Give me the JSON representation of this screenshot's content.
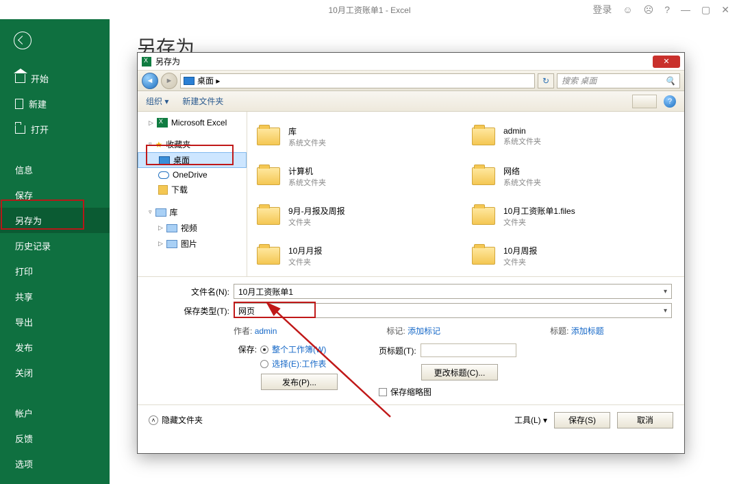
{
  "titlebar": {
    "title": "10月工资账单1  -  Excel",
    "login": "登录"
  },
  "sidebar": {
    "back": "返回",
    "items": [
      {
        "label": "开始",
        "icon": "home"
      },
      {
        "label": "新建",
        "icon": "doc"
      },
      {
        "label": "打开",
        "icon": "open"
      }
    ],
    "items2": [
      {
        "label": "信息"
      },
      {
        "label": "保存"
      },
      {
        "label": "另存为",
        "active": true
      },
      {
        "label": "历史记录"
      },
      {
        "label": "打印"
      },
      {
        "label": "共享"
      },
      {
        "label": "导出"
      },
      {
        "label": "发布"
      },
      {
        "label": "关闭"
      }
    ],
    "items3": [
      {
        "label": "帐户"
      },
      {
        "label": "反馈"
      },
      {
        "label": "选项"
      }
    ]
  },
  "main": {
    "heading": "另存为"
  },
  "dialog": {
    "title": "另存为",
    "breadcrumb": "桌面  ▸",
    "search_placeholder": "搜索 桌面",
    "toolbar": {
      "organize": "组织 ▾",
      "newfolder": "新建文件夹"
    },
    "tree": {
      "excel": "Microsoft Excel",
      "favorites": "收藏夹",
      "desktop": "桌面",
      "onedrive": "OneDrive",
      "downloads": "下载",
      "libraries": "库",
      "videos": "视频",
      "pictures": "图片"
    },
    "files": [
      {
        "name": "库",
        "sub": "系统文件夹"
      },
      {
        "name": "admin",
        "sub": "系统文件夹"
      },
      {
        "name": "计算机",
        "sub": "系统文件夹"
      },
      {
        "name": "网络",
        "sub": "系统文件夹"
      },
      {
        "name": "9月-月报及周报",
        "sub": "文件夹"
      },
      {
        "name": "10月工资账单1.files",
        "sub": "文件夹"
      },
      {
        "name": "10月月报",
        "sub": "文件夹"
      },
      {
        "name": "10月周报",
        "sub": "文件夹"
      }
    ],
    "filename_label": "文件名(N):",
    "filename_value": "10月工资账单1",
    "type_label": "保存类型(T):",
    "type_value": "网页",
    "meta": {
      "author_label": "作者:",
      "author_value": "admin",
      "tag_label": "标记:",
      "tag_value": "添加标记",
      "title_label": "标题:",
      "title_value": "添加标题"
    },
    "opts": {
      "save_label": "保存:",
      "whole": "整个工作簿(W)",
      "select": "选择(E):工作表",
      "publish": "发布(P)...",
      "pagetitle_label": "页标题(T):",
      "change_title": "更改标题(C)...",
      "thumbnail": "保存缩略图"
    },
    "footer": {
      "hidefolders": "隐藏文件夹",
      "tools": "工具(L)  ▾",
      "save": "保存(S)",
      "cancel": "取消"
    }
  }
}
